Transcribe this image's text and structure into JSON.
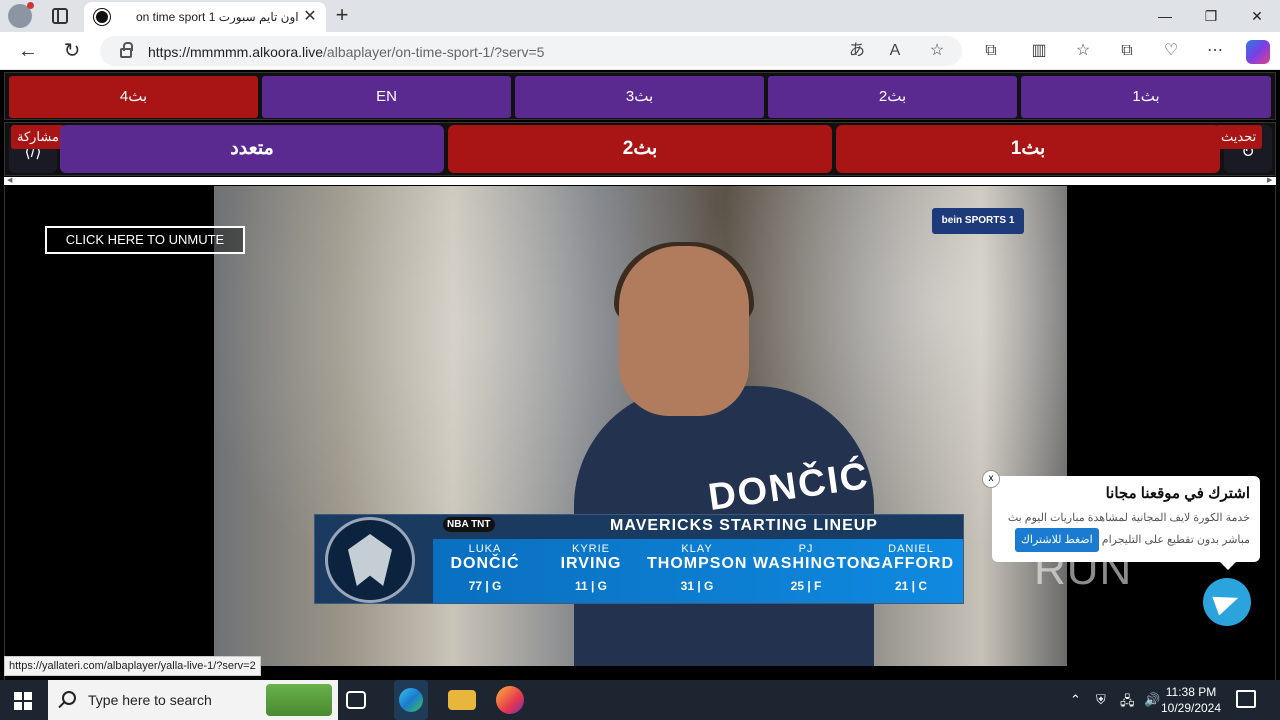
{
  "browser": {
    "tab_title": "on time sport 1 اون تايم سبورت",
    "tab_close": "✕",
    "new_tab": "+",
    "url_host": "https://mmmmm.alkoora.live",
    "url_path": "/albaplayer/on-time-sport-1/?serv=5",
    "window_controls": [
      "—",
      "❐",
      "✕"
    ]
  },
  "page": {
    "row1_buttons": [
      "بث4",
      "EN",
      "بث3",
      "بث2",
      "بث1"
    ],
    "row2_buttons": [
      "متعدد",
      "بث2",
      "بث1"
    ],
    "share_label": "مشاركة",
    "refresh_label": "تحديث",
    "unmute": "CLICK HERE TO UNMUTE",
    "colors": {
      "red": "#a91515",
      "purple": "#5a2a91",
      "telegram": "#2ba3dd"
    }
  },
  "video": {
    "network": "bein SPORTS 1",
    "jersey_name": "DONČIĆ",
    "lineup": {
      "network_tag": "NBA TNT",
      "title": "MAVERICKS STARTING LINEUP",
      "players": [
        {
          "first": "LUKA",
          "last": "DONČIĆ",
          "num": "77 | G"
        },
        {
          "first": "KYRIE",
          "last": "IRVING",
          "num": "11 | G"
        },
        {
          "first": "KLAY",
          "last": "THOMPSON",
          "num": "31 | G"
        },
        {
          "first": "PJ",
          "last": "WASHINGTON",
          "num": "25 | F"
        },
        {
          "first": "DANIEL",
          "last": "GAFFORD",
          "num": "21 | C"
        }
      ]
    }
  },
  "popup": {
    "close": "x",
    "title": "اشترك في موقعنا مجانا",
    "line1": "خدمة الكورة لايف المجانية لمشاهدة مباريات اليوم بث",
    "line2": "مباشر بدون تقطيع على التليجرام",
    "button": "اضغط للاشتراك"
  },
  "status_url": "https://yallateri.com/albaplayer/yalla-live-1/?serv=2",
  "watermark": "ANY ▷ RUN",
  "taskbar": {
    "search_placeholder": "Type here to search",
    "time": "11:38 PM",
    "date": "10/29/2024"
  }
}
